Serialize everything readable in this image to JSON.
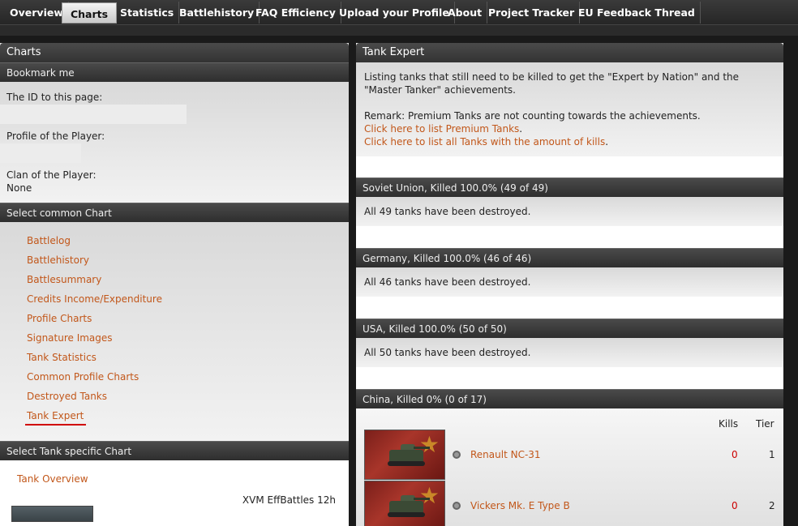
{
  "nav": {
    "items": [
      "Overview",
      "Charts",
      "Statistics",
      "Battlehistory",
      "FAQ Efficiency",
      "Upload your Profile",
      "About",
      "Project Tracker",
      "EU Feedback Thread"
    ],
    "active": "Charts"
  },
  "left": {
    "title": "Charts",
    "bookmark": {
      "heading": "Bookmark me",
      "id_label": "The ID to this page:",
      "profile_label": "Profile of the Player:",
      "clan_label": "Clan of the Player:",
      "clan_value": "None"
    },
    "common": {
      "heading": "Select common Chart",
      "links": [
        "Battlelog",
        "Battlehistory",
        "Battlesummary",
        "Credits Income/Expenditure",
        "Profile Charts",
        "Signature Images",
        "Tank Statistics",
        "Common Profile Charts",
        "Destroyed Tanks",
        "Tank Expert"
      ],
      "current": "Tank Expert"
    },
    "tank_specific": {
      "heading": "Select Tank specific Chart",
      "overview_link": "Tank Overview",
      "columns": "XVM EffBattles 12h"
    }
  },
  "right": {
    "title": "Tank Expert",
    "intro": "Listing tanks that still need to be killed to get the \"Expert by Nation\" and the \"Master Tanker\" achievements.",
    "remark": "Remark: Premium Tanks are not counting towards the achievements.",
    "premium_link": "Click here to list Premium Tanks",
    "all_link": "Click here to list all Tanks with the amount of kills",
    "nations": [
      {
        "heading": "Soviet Union, Killed 100.0% (49 of 49)",
        "message": "All 49 tanks have been destroyed."
      },
      {
        "heading": "Germany, Killed 100.0% (46 of 46)",
        "message": "All 46 tanks have been destroyed."
      },
      {
        "heading": "USA, Killed 100.0% (50 of 50)",
        "message": "All 50 tanks have been destroyed."
      }
    ],
    "china": {
      "heading": "China, Killed 0% (0 of 17)",
      "kills_header": "Kills",
      "tier_header": "Tier",
      "tanks": [
        {
          "name": "Renault NC-31",
          "kills": "0",
          "tier": "1"
        },
        {
          "name": "Vickers Mk. E Type B",
          "kills": "0",
          "tier": "2"
        }
      ]
    }
  },
  "colors": {
    "link": "#c2571a",
    "kills": "#cc0000",
    "underline": "#d00000"
  }
}
